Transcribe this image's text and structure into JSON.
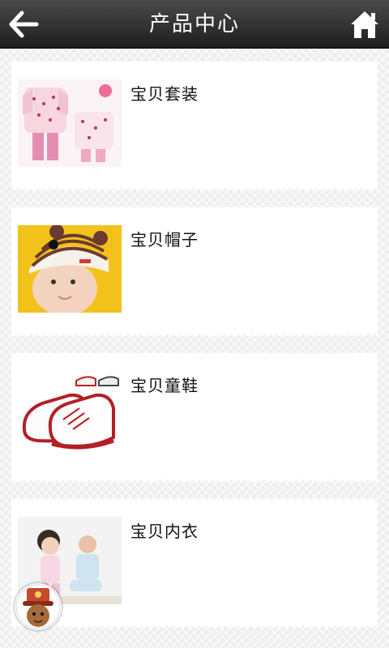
{
  "header": {
    "title": "产品中心",
    "back_icon": "arrow-left-icon",
    "home_icon": "home-icon"
  },
  "products": [
    {
      "label": "宝贝套装",
      "image": "baby-outfit-set-image"
    },
    {
      "label": "宝贝帽子",
      "image": "baby-hat-image"
    },
    {
      "label": "宝贝童鞋",
      "image": "baby-shoes-image"
    },
    {
      "label": "宝贝内衣",
      "image": "baby-underwear-image"
    }
  ],
  "floating_button": {
    "icon": "mascot-avatar-icon"
  },
  "colors": {
    "header_top": "#4a4a4a",
    "header_bottom": "#1e1e1e",
    "background": "#eeeeee",
    "card": "#ffffff"
  }
}
